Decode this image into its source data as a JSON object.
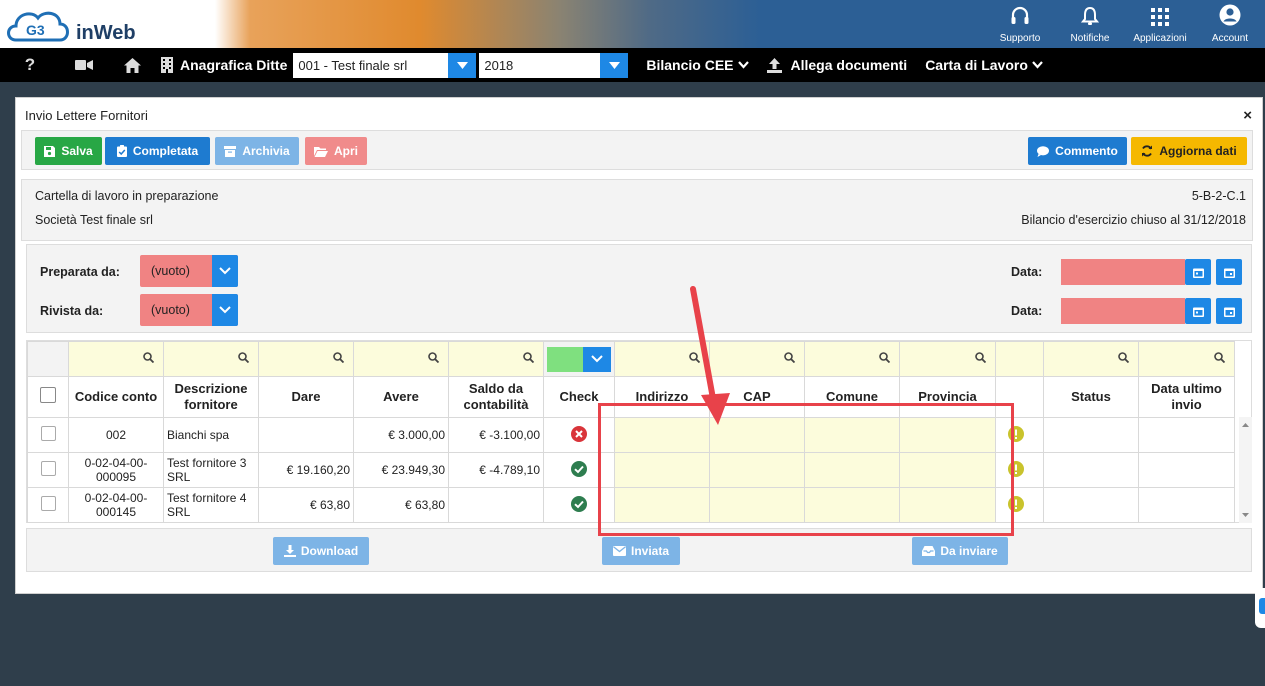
{
  "header": {
    "logo_text": "inWeb",
    "logo_badge": "G3",
    "actions": [
      {
        "label": "Supporto",
        "icon": "headset-icon"
      },
      {
        "label": "Notifiche",
        "icon": "bell-icon"
      },
      {
        "label": "Applicazioni",
        "icon": "grid-icon"
      },
      {
        "label": "Account",
        "icon": "user-icon"
      }
    ]
  },
  "nav": {
    "help": "?",
    "anagrafica": "Anagrafica Ditte",
    "company_value": "001 - Test finale srl",
    "year_value": "2018",
    "bilancio": "Bilancio CEE",
    "allega": "Allega documenti",
    "carta": "Carta di Lavoro"
  },
  "modal": {
    "title": "Invio Lettere Fornitori",
    "close": "×",
    "buttons": {
      "salva": "Salva",
      "completata": "Completata",
      "archivia": "Archivia",
      "apri": "Apri",
      "commento": "Commento",
      "aggiorna": "Aggiorna dati"
    },
    "colors": {
      "salva": "#28a745",
      "completata": "#1e7bd0",
      "archivia": "#7db4e6",
      "apri": "#f08b8b",
      "commento": "#1e7bd0",
      "aggiorna": "#f5b800"
    }
  },
  "info": {
    "line1": "Cartella di lavoro in preparazione",
    "line2": "Società Test finale srl",
    "code": "5-B-2-C.1",
    "bilancio": "Bilancio d'esercizio chiuso al 31/12/2018"
  },
  "filters": {
    "preparata_label": "Preparata da:",
    "preparata_value": "(vuoto)",
    "rivista_label": "Rivista da:",
    "rivista_value": "(vuoto)",
    "data_label": "Data:"
  },
  "table": {
    "headers": [
      "Codice conto",
      "Descrizione fornitore",
      "Dare",
      "Avere",
      "Saldo da contabilità",
      "Check",
      "Indirizzo",
      "CAP",
      "Comune",
      "Provincia",
      "",
      "Status",
      "Data ultimo invio"
    ],
    "rows": [
      {
        "codice": "002",
        "descrizione": "Bianchi spa",
        "dare": "",
        "avere": "€ 3.000,00",
        "saldo": "€ -3.100,00",
        "check": "error"
      },
      {
        "codice": "0-02-04-00-000095",
        "descrizione": "Test fornitore 3 SRL",
        "dare": "€ 19.160,20",
        "avere": "€ 23.949,30",
        "saldo": "€ -4.789,10",
        "check": "ok"
      },
      {
        "codice": "0-02-04-00-000145",
        "descrizione": "Test fornitore 4 SRL",
        "dare": "€ 63,80",
        "avere": "€ 63,80",
        "saldo": "",
        "check": "ok"
      }
    ]
  },
  "footer": {
    "download": "Download",
    "inviata": "Inviata",
    "da_inviare": "Da inviare"
  }
}
